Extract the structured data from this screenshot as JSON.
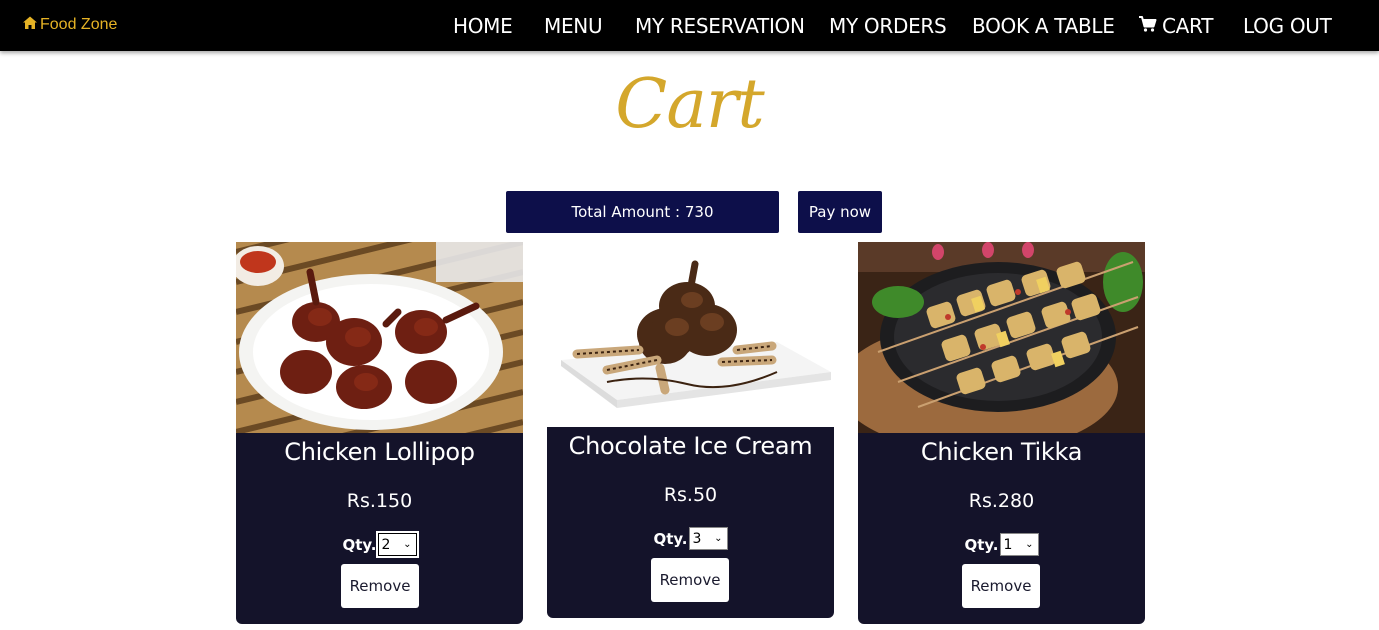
{
  "nav": {
    "brand": "Food Zone",
    "links": [
      "HOME",
      "MENU",
      "MY RESERVATION",
      "MY ORDERS",
      "BOOK A TABLE",
      "CART",
      "LOG OUT"
    ]
  },
  "page": {
    "title": "Cart",
    "total_label": "Total Amount : 730",
    "pay_label": "Pay now"
  },
  "items": [
    {
      "name": "Chicken Lollipop",
      "price": "Rs.150",
      "qty_label": "Qty.",
      "qty": "2",
      "remove_label": "Remove"
    },
    {
      "name": "Chocolate Ice Cream",
      "price": "Rs.50",
      "qty_label": "Qty.",
      "qty": "3",
      "remove_label": "Remove"
    },
    {
      "name": "Chicken Tikka",
      "price": "Rs.280",
      "qty_label": "Qty.",
      "qty": "1",
      "remove_label": "Remove"
    }
  ],
  "colors": {
    "brand": "#e6b325",
    "title": "#d4a72c",
    "button_bg": "#0d0f4a",
    "card_bg": "#14132a"
  }
}
